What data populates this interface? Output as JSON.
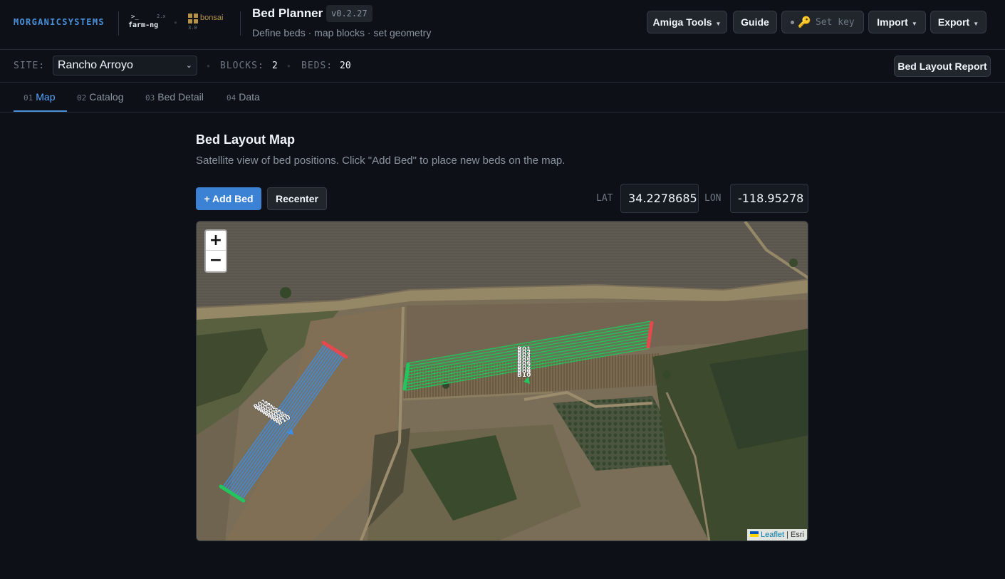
{
  "header": {
    "brand": "MORGANICSYSTEMS",
    "farmng": {
      "prompt": ">_",
      "name": "farm-ng",
      "version": "2.x"
    },
    "bonsai": {
      "name": "bonsai",
      "version": "3.0"
    },
    "title": "Bed Planner",
    "version": "v0.2.27",
    "subtitle": "Define beds · map blocks · set geometry",
    "buttons": {
      "amiga_tools": "Amiga Tools",
      "guide": "Guide",
      "set_key": "Set key",
      "import": "Import",
      "export": "Export"
    }
  },
  "site_bar": {
    "site_label": "SITE:",
    "site_value": "Rancho Arroyo",
    "blocks_label": "BLOCKS:",
    "blocks_count": "2",
    "beds_label": "BEDS:",
    "beds_count": "20",
    "report_button": "Bed Layout Report"
  },
  "tabs": [
    {
      "num": "01",
      "label": "Map",
      "active": true
    },
    {
      "num": "02",
      "label": "Catalog",
      "active": false
    },
    {
      "num": "03",
      "label": "Bed Detail",
      "active": false
    },
    {
      "num": "04",
      "label": "Data",
      "active": false
    }
  ],
  "main": {
    "title": "Bed Layout Map",
    "description": "Satellite view of bed positions. Click \"Add Bed\" to place new beds on the map.",
    "add_bed_button": "+ Add Bed",
    "recenter_button": "Recenter",
    "lat_label": "LAT",
    "lat_value": "34.2278685",
    "lon_label": "LON",
    "lon_value": "-118.95278"
  },
  "map": {
    "zoom_in": "+",
    "zoom_out": "−",
    "attribution_link": "Leaflet",
    "attribution_sep": " | ",
    "attribution_source": "Esri",
    "blocks": [
      {
        "color": "#3b8de6",
        "bed_labels": [
          "B01",
          "B02",
          "B03",
          "B04",
          "B05",
          "B06",
          "B07",
          "B08",
          "B09",
          "B10"
        ]
      },
      {
        "color": "#22c55e",
        "bed_labels": [
          "B01",
          "B02",
          "B03",
          "B04",
          "B05",
          "B06",
          "B07",
          "B08",
          "B09",
          "B10"
        ]
      }
    ],
    "start_color": "#22c55e",
    "end_color": "#e5484d"
  }
}
